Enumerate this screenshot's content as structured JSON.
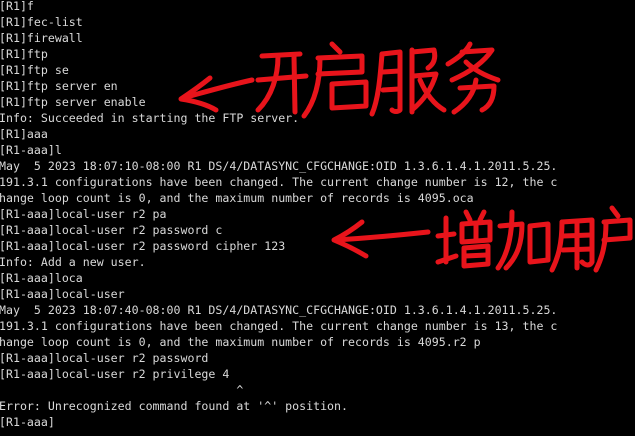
{
  "terminal": {
    "background": "#000000",
    "text_color": "#d9d9d9",
    "lines": [
      "[R1]f",
      "[R1]fec-list",
      "[R1]firewall",
      "[R1]ftp",
      "[R1]ftp se",
      "[R1]ftp server en",
      "[R1]ftp server enable",
      "Info: Succeeded in starting the FTP server.",
      "[R1]aaa",
      "[R1-aaa]l",
      "May  5 2023 18:07:10-08:00 R1 DS/4/DATASYNC_CFGCHANGE:OID 1.3.6.1.4.1.2011.5.25.",
      "191.3.1 configurations have been changed. The current change number is 12, the c",
      "hange loop count is 0, and the maximum number of records is 4095.oca",
      "[R1-aaa]local-user r2 pa",
      "[R1-aaa]local-user r2 password c",
      "[R1-aaa]local-user r2 password cipher 123",
      "Info: Add a new user.",
      "[R1-aaa]loca",
      "[R1-aaa]local-user",
      "May  5 2023 18:07:40-08:00 R1 DS/4/DATASYNC_CFGCHANGE:OID 1.3.6.1.4.1.2011.5.25.",
      "191.3.1 configurations have been changed. The current change number is 13, the c",
      "hange loop count is 0, and the maximum number of records is 4095.r2 p",
      "[R1-aaa]local-user r2 password",
      "[R1-aaa]local-user r2 privilege 4",
      "                                  ^",
      "Error: Unrecognized command found at '^' position.",
      "[R1-aaa]"
    ]
  },
  "annotations": {
    "color": "#e8141b",
    "start_ftp_service": "开启服务",
    "add_user": "增加用户"
  }
}
